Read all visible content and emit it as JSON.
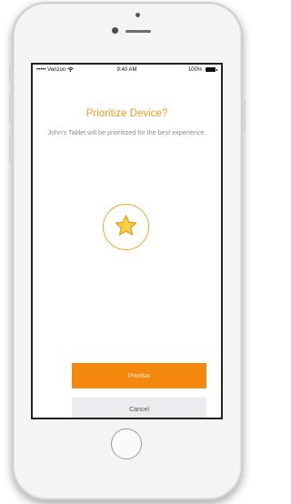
{
  "status_bar": {
    "carrier": "••••• Verizon",
    "wifi_icon": "wifi-icon",
    "time": "9:40 AM",
    "battery": "100%",
    "battery_icon": "battery-icon"
  },
  "dialog": {
    "title": "Prioritize Device?",
    "subtitle": "John's Tablet will be prioritized for the best experience.",
    "icon": "star-icon"
  },
  "buttons": {
    "primary_label": "Prioritze",
    "secondary_label": "Cancel"
  },
  "colors": {
    "accent": "#f4890d",
    "title": "#f59a1b",
    "star_fill": "#fcd146",
    "secondary_button": "#ececee"
  }
}
